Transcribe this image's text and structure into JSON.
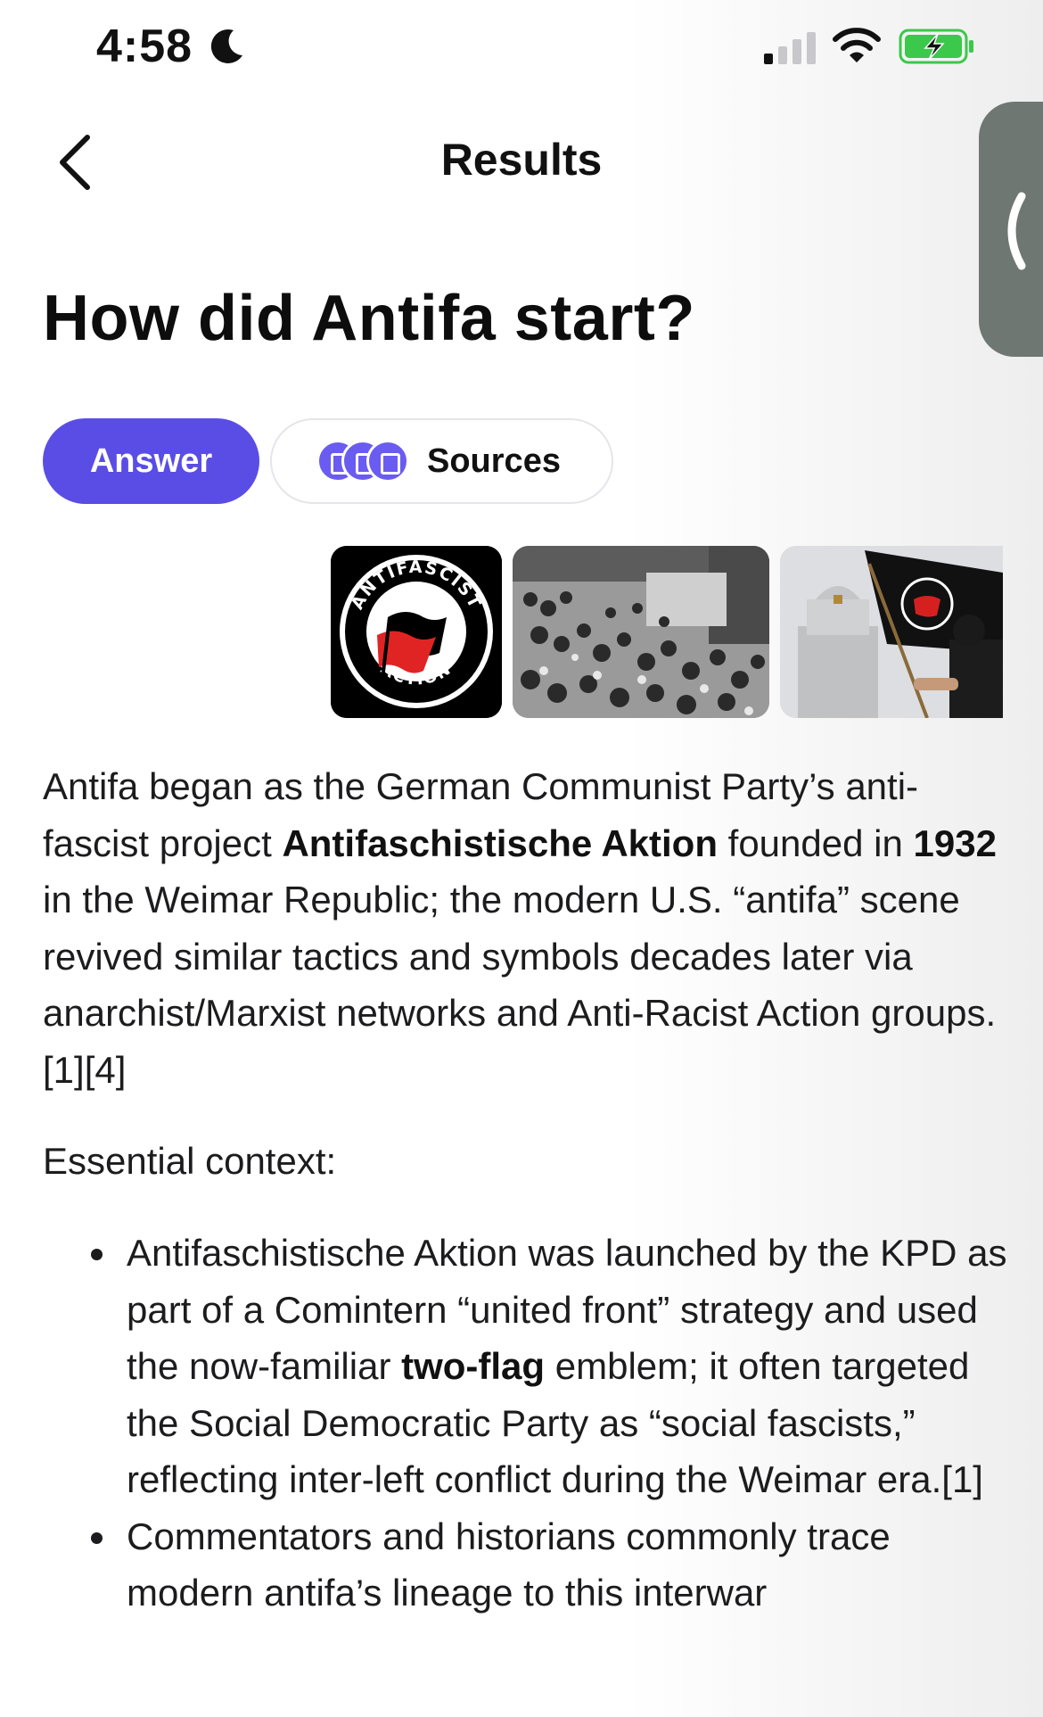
{
  "status_bar": {
    "time": "4:58",
    "icons": [
      "moon-icon",
      "cellular-signal-icon",
      "wifi-icon",
      "battery-charging-icon"
    ]
  },
  "header": {
    "title": "Results",
    "back_icon": "chevron-left-icon"
  },
  "side_tab": {
    "icon": "chevron-left-icon"
  },
  "question": "How did Antifa start?",
  "tabs": {
    "answer_label": "Answer",
    "sources_label": "Sources",
    "selected": "Answer"
  },
  "images": [
    {
      "alt": "ANTIFASCIST ACTION logo",
      "logo_top": "ANTIFASCIST",
      "logo_bottom": "ACTION"
    },
    {
      "alt": "Historical black-and-white crowd photo"
    },
    {
      "alt": "Protester with antifa flag near capitol"
    }
  ],
  "answer": {
    "p1_parts": [
      "Antifa began as the German Communist Party’s anti-fascist project ",
      "Antifaschistische Aktion",
      " founded in ",
      "1932",
      " in the Weimar Republic; the modern U.S. “antifa” scene revived similar tactics and symbols decades later via anarchist/Marxist networks and Anti-Racist Action groups.[1][4]"
    ],
    "context_heading": "Essential context:",
    "bullet1_parts": [
      "Antifaschistische Aktion was launched by the KPD as part of a Comintern “united front” strategy and used the now-familiar ",
      "two-flag",
      " emblem; it often targeted the Social Democratic Party as “social fascists,” reflecting inter-left conflict during the Weimar era.[1]"
    ],
    "bullet2": "Commentators and historians commonly trace modern antifa’s lineage to this interwar"
  },
  "colors": {
    "accent": "#5a4de6",
    "side_tab": "#6f7772",
    "battery_green": "#3cc84a",
    "text": "#1c1c1e"
  }
}
